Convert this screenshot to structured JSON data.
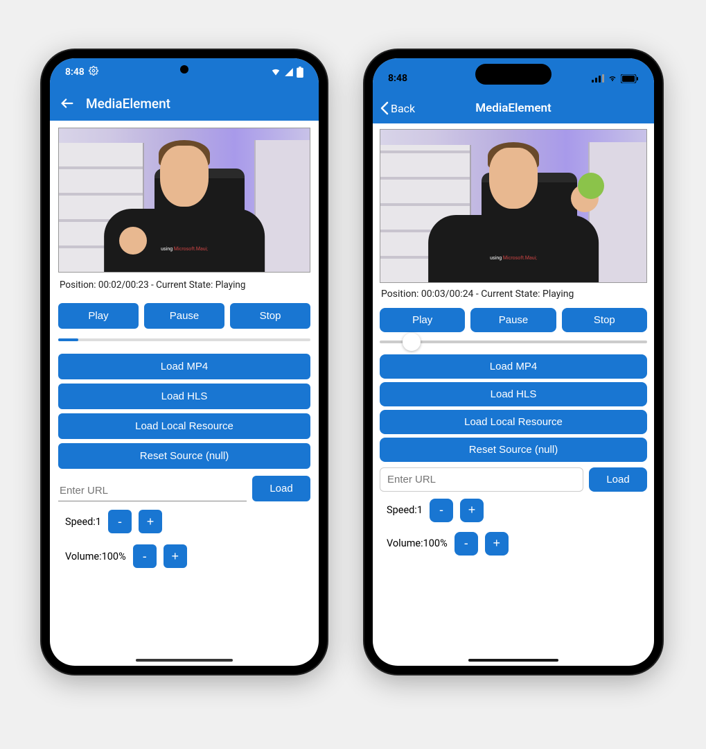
{
  "android": {
    "status_time": "8:48",
    "header_title": "MediaElement",
    "position_line": "Position: 00:02/00:23 - Current State: Playing",
    "shirt_text_prefix": "using ",
    "shirt_text_colored": "Microsoft.Maui;",
    "buttons": {
      "play": "Play",
      "pause": "Pause",
      "stop": "Stop"
    },
    "load": {
      "mp4": "Load MP4",
      "hls": "Load HLS",
      "local": "Load Local Resource",
      "reset": "Reset Source (null)"
    },
    "url_placeholder": "Enter URL",
    "load_btn": "Load",
    "speed_label": "Speed:",
    "speed_value": "1",
    "volume_label": "Volume:",
    "volume_value": "100%",
    "minus": "-",
    "plus": "+"
  },
  "ios": {
    "status_time": "8:48",
    "back_label": "Back",
    "header_title": "MediaElement",
    "position_line": "Position: 00:03/00:24 - Current State: Playing",
    "shirt_text_prefix": "using ",
    "shirt_text_colored": "Microsoft.Maui;",
    "buttons": {
      "play": "Play",
      "pause": "Pause",
      "stop": "Stop"
    },
    "load": {
      "mp4": "Load MP4",
      "hls": "Load HLS",
      "local": "Load Local Resource",
      "reset": "Reset Source (null)"
    },
    "url_placeholder": "Enter URL",
    "load_btn": "Load",
    "speed_label": "Speed:",
    "speed_value": "1",
    "volume_label": "Volume:",
    "volume_value": "100%",
    "minus": "-",
    "plus": "+"
  }
}
